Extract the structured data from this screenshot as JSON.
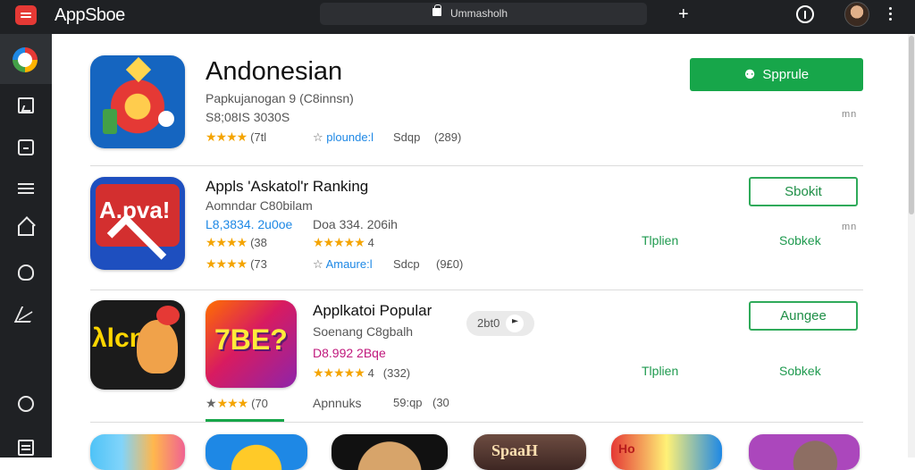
{
  "window": {
    "title": "AppSboe",
    "address": "Ummasholh"
  },
  "featured": {
    "name": "Andonesian",
    "subtitle": "Papkujanogan 9 (C8innsn)",
    "size_line": "S8;08IS 3030S",
    "rating_count": "(7tl",
    "publisher": "plounde:l",
    "version": "Sdqp",
    "reviews": "(289)",
    "install_label": "Spprule",
    "mark": "mn"
  },
  "section1": {
    "title": "Appls 'Askatol'r Ranking",
    "subtitle": "Aomndar C80bilam",
    "item1": {
      "icon_text": "A.pva!",
      "line1": "L8,3834. 2u0oe",
      "rating_count": "(38",
      "rating_count_2": "(73",
      "author": "Amaure:l",
      "version": "Sdcp",
      "reviews": "(9£0)"
    },
    "item2": {
      "line1": "Doa 334. 206ih",
      "rating_value": "4"
    },
    "button_label": "Sbokit",
    "mark": "mn",
    "link1": "Tlplien",
    "link2": "Sobkek"
  },
  "section2": {
    "title": "Applkatoi Popular",
    "subtitle": "Soenang C8gbalh",
    "icon_left_text": "λlcnı",
    "icon_right_text": "7BE?",
    "pill_text": "2bt0",
    "price_line": "D8.992 2Bqe",
    "rating_value": "4",
    "reviews": "(332)",
    "rating_count": "(70",
    "category": "Apnnuks",
    "version": "59:qp",
    "reviews2": "(30",
    "button_label": "Aungee",
    "link1": "Tlplien",
    "link2": "Sobkek"
  },
  "bottom_row": {
    "icon3_text": "SpaaH",
    "icon5_text": "Ho"
  },
  "colors": {
    "accent_green": "#17a64a",
    "star_gold": "#f4a400",
    "titlebar": "#1f2124",
    "price_pink": "#c0187c",
    "link_blue": "#1e88e5"
  },
  "icons": [
    "app-logo",
    "lock-icon",
    "plus-icon",
    "info-icon",
    "avatar",
    "kebab-icon",
    "image-icon",
    "box-icon",
    "menu-icon",
    "home-icon",
    "puzzle-icon",
    "send-icon",
    "circle-icon",
    "list-icon",
    "person-icon"
  ]
}
